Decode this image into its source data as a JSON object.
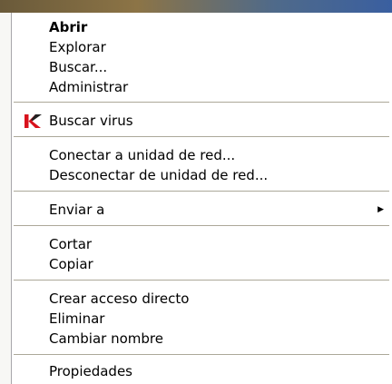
{
  "context_menu": {
    "items": [
      {
        "label": "Abrir"
      },
      {
        "label": "Explorar"
      },
      {
        "label": "Buscar..."
      },
      {
        "label": "Administrar"
      },
      {
        "label": "Buscar virus"
      },
      {
        "label": "Conectar a unidad de red..."
      },
      {
        "label": "Desconectar de unidad de red..."
      },
      {
        "label": "Enviar a"
      },
      {
        "label": "Cortar"
      },
      {
        "label": "Copiar"
      },
      {
        "label": "Crear acceso directo"
      },
      {
        "label": "Eliminar"
      },
      {
        "label": "Cambiar nombre"
      },
      {
        "label": "Propiedades"
      }
    ],
    "default_item": "Abrir",
    "kaspersky_icon": "kaspersky-k-icon",
    "submenu_arrow_icon": "triangle-right-icon",
    "colors": {
      "kaspersky_red": "#d8121c",
      "separator": "#aca899",
      "border": "#a7a6aa"
    }
  }
}
